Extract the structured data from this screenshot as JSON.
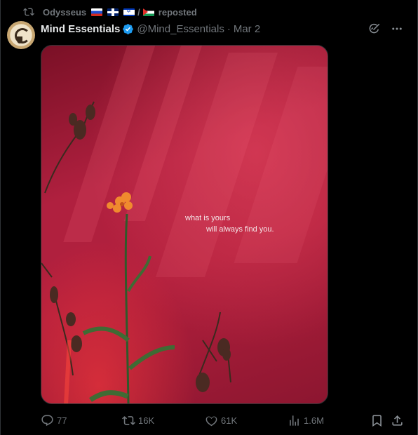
{
  "repost": {
    "user": "Odysseus",
    "separator": "/",
    "label": "reposted",
    "flags": [
      "flag-russia",
      "flag-uk",
      "flag-israel",
      "flag-palestine"
    ]
  },
  "author": {
    "name": "Mind Essentials",
    "handle": "@Mind_Essentials",
    "dot": "·",
    "date": "Mar 2"
  },
  "media": {
    "quote_line1": "what is yours",
    "quote_line2": "will always find you."
  },
  "stats": {
    "replies": "77",
    "reposts": "16K",
    "likes": "61K",
    "views": "1.6M"
  },
  "colors": {
    "background": "#000000",
    "muted_text": "#71767b",
    "verified": "#1d9bf0",
    "media_red": "#b0203f"
  },
  "icons": {
    "repost": "repost-icon",
    "verified": "verified-badge-icon",
    "grok": "grok-icon",
    "more": "more-icon",
    "reply": "reply-icon",
    "like": "heart-icon",
    "views": "views-icon",
    "bookmark": "bookmark-icon",
    "share": "share-icon"
  }
}
